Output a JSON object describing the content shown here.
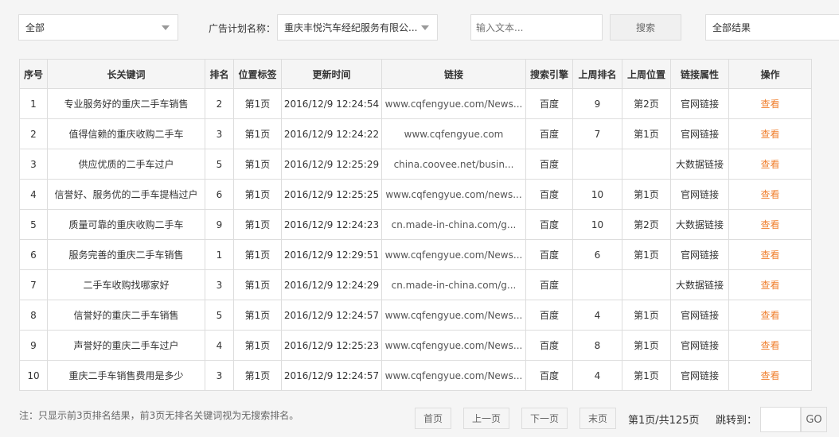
{
  "filters": {
    "scope": "全部",
    "plan_label": "广告计划名称：",
    "plan_value": "重庆丰悦汽车经纪服务有限公...",
    "search_placeholder": "输入文本...",
    "search_button": "搜索",
    "result_filter": "全部结果"
  },
  "table": {
    "headers": [
      "序号",
      "长关键词",
      "排名",
      "位置标签",
      "更新时间",
      "链接",
      "搜索引擎",
      "上周排名",
      "上周位置",
      "链接属性",
      "操作"
    ],
    "rows": [
      [
        "1",
        "专业服务好的重庆二手车销售",
        "2",
        "第1页",
        "2016/12/9 12:24:54",
        "www.cqfengyue.com/News...",
        "百度",
        "9",
        "第2页",
        "官网链接",
        "查看"
      ],
      [
        "2",
        "值得信赖的重庆收购二手车",
        "3",
        "第1页",
        "2016/12/9 12:24:22",
        "www.cqfengyue.com",
        "百度",
        "7",
        "第1页",
        "官网链接",
        "查看"
      ],
      [
        "3",
        "供应优质的二手车过户",
        "5",
        "第1页",
        "2016/12/9 12:25:29",
        "china.coovee.net/busin...",
        "百度",
        "",
        "",
        "大数据链接",
        "查看"
      ],
      [
        "4",
        "信誉好、服务优的二手车提档过户",
        "6",
        "第1页",
        "2016/12/9 12:25:25",
        "www.cqfengyue.com/news...",
        "百度",
        "10",
        "第1页",
        "官网链接",
        "查看"
      ],
      [
        "5",
        "质量可靠的重庆收购二手车",
        "9",
        "第1页",
        "2016/12/9 12:24:23",
        "cn.made-in-china.com/g...",
        "百度",
        "10",
        "第2页",
        "大数据链接",
        "查看"
      ],
      [
        "6",
        "服务完善的重庆二手车销售",
        "1",
        "第1页",
        "2016/12/9 12:29:51",
        "www.cqfengyue.com/News...",
        "百度",
        "6",
        "第1页",
        "官网链接",
        "查看"
      ],
      [
        "7",
        "二手车收购找哪家好",
        "3",
        "第1页",
        "2016/12/9 12:24:29",
        "cn.made-in-china.com/g...",
        "百度",
        "",
        "",
        "大数据链接",
        "查看"
      ],
      [
        "8",
        "信誉好的重庆二手车销售",
        "5",
        "第1页",
        "2016/12/9 12:24:57",
        "www.cqfengyue.com/News...",
        "百度",
        "4",
        "第1页",
        "官网链接",
        "查看"
      ],
      [
        "9",
        "声誉好的重庆二手车过户",
        "4",
        "第1页",
        "2016/12/9 12:25:23",
        "www.cqfengyue.com/News...",
        "百度",
        "8",
        "第1页",
        "官网链接",
        "查看"
      ],
      [
        "10",
        "重庆二手车销售费用是多少",
        "3",
        "第1页",
        "2016/12/9 12:24:57",
        "www.cqfengyue.com/News...",
        "百度",
        "4",
        "第1页",
        "官网链接",
        "查看"
      ]
    ]
  },
  "footer": {
    "note": "注：只显示前3页排名结果，前3页无排名关键词视为无搜索排名。",
    "first": "首页",
    "prev": "上一页",
    "next": "下一页",
    "last": "末页",
    "page_info": "第1页/共125页",
    "jump_label": "跳转到：",
    "go": "GO"
  }
}
